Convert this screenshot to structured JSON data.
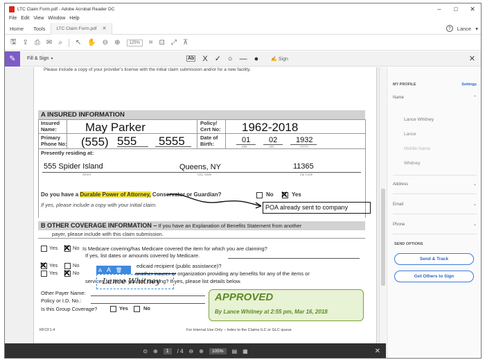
{
  "window": {
    "title": "LTC Claim Form.pdf - Adobe Acrobat Reader DC",
    "controls": [
      "–",
      "□",
      "✕"
    ]
  },
  "menu": [
    "File",
    "Edit",
    "View",
    "Window",
    "Help"
  ],
  "tabs": {
    "home": "Home",
    "tools": "Tools",
    "document": "LTC Claim Form.pdf",
    "document_close": "✕",
    "help": "?",
    "user": "Lance"
  },
  "toolbar": {
    "zoom": "125%"
  },
  "fill_sign": {
    "label": "Fill & Sign",
    "text_tool": "Ab",
    "sign": "Sign"
  },
  "form": {
    "top_note": "Please include a copy of your provider's license with the initial claim submission and/or for a new facility.",
    "section_a": "A  INSURED INFORMATION",
    "insured_name_label": "Insured Name:",
    "insured_name": "May Parker",
    "policy_label": "Policy/ Cert No:",
    "policy_number": "1962-2018",
    "phone_label": "Primary Phone No:",
    "phone_area": "555",
    "phone_prefix": "555",
    "phone_line": "5555",
    "dob_label": "Date of Birth:",
    "dob_month": "01",
    "dob_day": "02",
    "dob_year": "1932",
    "dob_mm": "MM",
    "dob_dd": "DD",
    "dob_yyyy": "YYYY",
    "residing_label": "Presently residing at:",
    "street": "555 Spider Island",
    "city": "Queens, NY",
    "zip": "11365",
    "street_cap": "Street",
    "city_cap": "City, State",
    "zip_cap": "Zip Code",
    "poa_question_pre": "Do you have a ",
    "poa_highlight": "Durable Power of Attorney,",
    "poa_question_post": " Conservator or Guardian?",
    "no": "No",
    "yes": "Yes",
    "poa_note": "If yes, please include a copy with your initial claim.",
    "poa_comment": "POA already sent to company",
    "section_b": "B OTHER COVERAGE INFORMATION –",
    "section_b_note": " If you have an Explanation of Benefits Statement from another",
    "section_b_note2": "payer, please include with this claim submission.",
    "q1": "Is Medicare covering/has Medicare covered the item for which you are claiming?",
    "q1b": "If yes, list dates or amounts covered by Medicare.",
    "q2": "edicaid recipient (public assistance)?",
    "q3_strike": "another insurer or",
    "q3": "organization providing any benefits for any of the items or",
    "q3b": "services for which you are claiming? If yes, please list details below.",
    "other_payer": "Other Payer Name:",
    "policy_id": "Policy or I.D. No.:",
    "group_cov": "Is this Group Coverage?",
    "signature_text": "Lance Whitney",
    "approved_title": "APPROVED",
    "approved_sub": "By Lance Whitney at 2:55 pm, Mar 16, 2018",
    "footer_left": "RFCF1.4",
    "footer_center": "For Internal Use Only – Index to the Claims ILC or GLC queue"
  },
  "bottom": {
    "page_current": "1",
    "page_total": "/ 4",
    "zoom": "105%"
  },
  "profile": {
    "title": "MY PROFILE",
    "settings": "Settings",
    "name_label": "Name",
    "full_name": "Lance Whitney",
    "first": "Lance",
    "middle_placeholder": "Middle Name",
    "last": "Whitney",
    "address": "Address",
    "email": "Email",
    "phone": "Phone",
    "send_options": "SEND OPTIONS",
    "send_track": "Send & Track",
    "get_others": "Get Others to Sign"
  }
}
